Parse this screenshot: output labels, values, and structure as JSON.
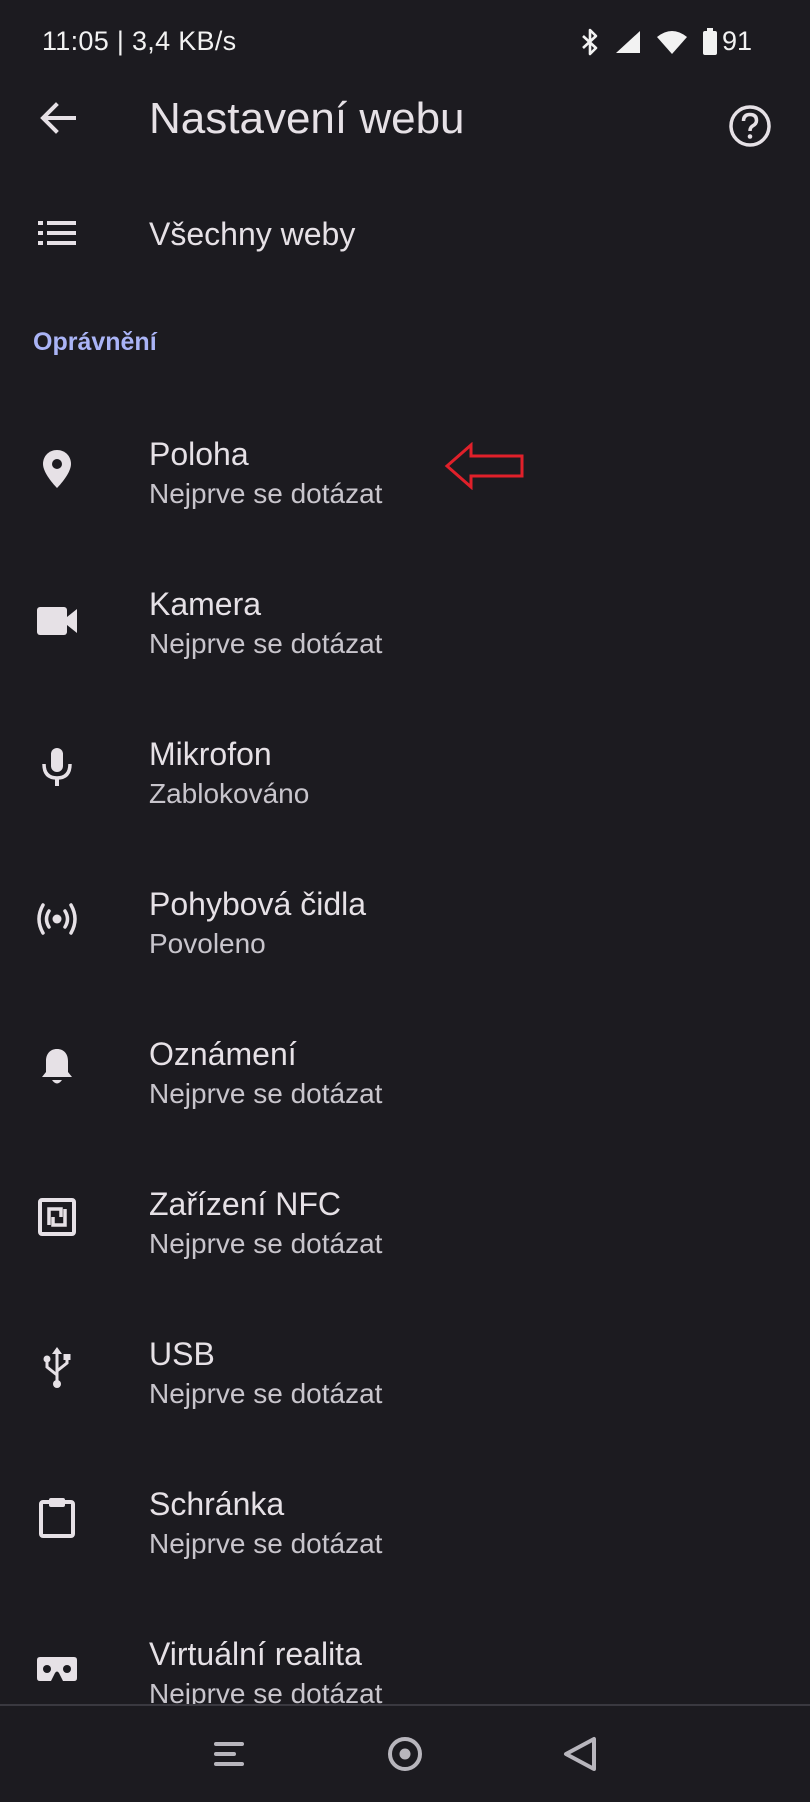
{
  "status_bar": {
    "time_speed": "11:05 | 3,4 KB/s",
    "battery": "91",
    "icons": [
      "bluetooth-icon",
      "signal-icon",
      "wifi-icon",
      "battery-icon"
    ]
  },
  "app_bar": {
    "title": "Nastavení webu",
    "back_icon": "arrow-back-icon",
    "help_icon": "help-circle-icon"
  },
  "all_sites": {
    "label": "Všechny weby",
    "icon": "list-icon"
  },
  "section": {
    "title": "Oprávnění"
  },
  "permissions": [
    {
      "title": "Poloha",
      "status": "Nejprve se dotázat",
      "icon": "location-pin-icon"
    },
    {
      "title": "Kamera",
      "status": "Nejprve se dotázat",
      "icon": "videocam-icon"
    },
    {
      "title": "Mikrofon",
      "status": "Zablokováno",
      "icon": "mic-icon"
    },
    {
      "title": "Pohybová čidla",
      "status": "Povoleno",
      "icon": "sensors-icon"
    },
    {
      "title": "Oznámení",
      "status": "Nejprve se dotázat",
      "icon": "bell-icon"
    },
    {
      "title": "Zařízení NFC",
      "status": "Nejprve se dotázat",
      "icon": "nfc-icon"
    },
    {
      "title": "USB",
      "status": "Nejprve se dotázat",
      "icon": "usb-icon"
    },
    {
      "title": "Schránka",
      "status": "Nejprve se dotázat",
      "icon": "clipboard-icon"
    },
    {
      "title": "Virtuální realita",
      "status": "Nejprve se dotázat",
      "icon": "vr-headset-icon"
    }
  ],
  "annotation": {
    "icon": "red-arrow-left-icon",
    "color": "#e0202a"
  },
  "nav_bar": {
    "icons": [
      "nav-recents-icon",
      "nav-home-icon",
      "nav-back-icon"
    ]
  },
  "colors": {
    "background": "#1c1b20",
    "text_primary": "#e6e1e6",
    "text_secondary": "#c8c5cc",
    "accent": "#aab4f6"
  }
}
